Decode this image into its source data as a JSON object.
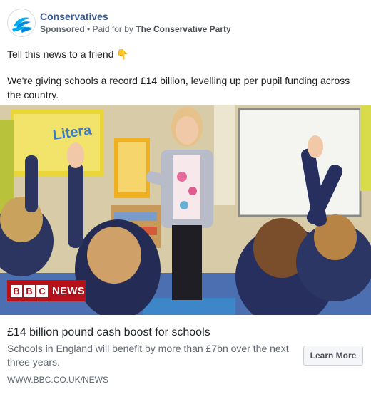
{
  "ad": {
    "page_name": "Conservatives",
    "sponsored_label": "Sponsored",
    "separator": "•",
    "paid_for_prefix": "Paid for by",
    "paid_for_by": "The Conservative Party",
    "share_prompt": "Tell this news to a friend",
    "share_emoji": "👇",
    "body_text": "We're giving schools a record £14 billion, levelling up per pupil funding across the country."
  },
  "image": {
    "description_icon": "classroom-photo",
    "overlay_logo": {
      "letters": [
        "B",
        "B",
        "C"
      ],
      "word": "NEWS"
    }
  },
  "link_preview": {
    "title": "£14 billion pound cash boost for schools",
    "description": "Schools in England will benefit by more than £7bn over the next three years.",
    "url": "WWW.BBC.CO.UK/NEWS",
    "cta_label": "Learn More"
  },
  "colors": {
    "page_name": "#385898",
    "bbc_red": "#b4111a",
    "conservatives_blue": "#00aeef"
  }
}
